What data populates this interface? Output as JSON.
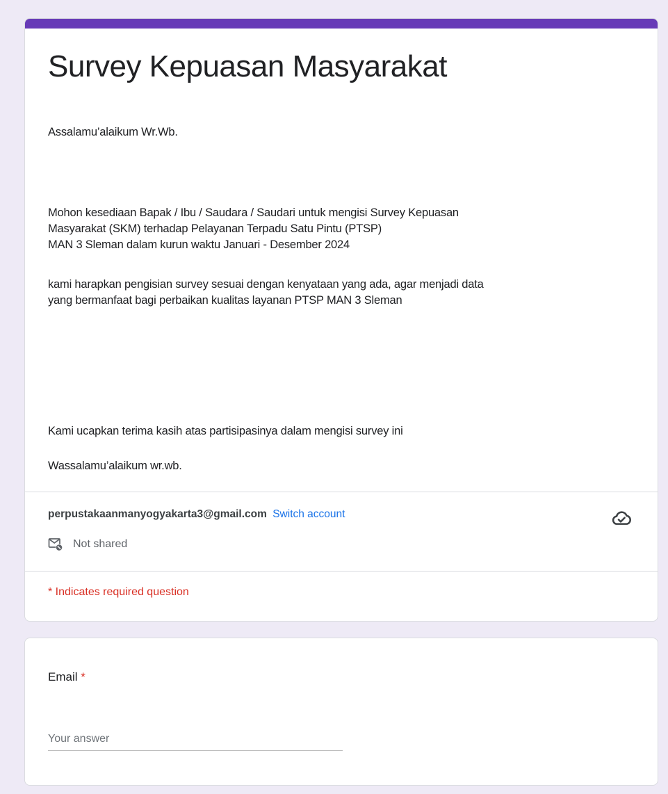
{
  "form": {
    "accent_color": "#673ab7",
    "title": "Survey Kepuasan Masyarakat",
    "description": {
      "greeting": "Assalamu’alaikum Wr.Wb.",
      "para1_line1": "Mohon kesediaan Bapak / Ibu / Saudara / Saudari untuk mengisi Survey Kepuasan",
      "para1_line2": "Masyarakat (SKM) terhadap Pelayanan Terpadu Satu Pintu (PTSP)",
      "para1_line3": "MAN 3 Sleman  dalam kurun waktu Januari - Desember 2024",
      "para2_line1": "kami harapkan pengisian survey sesuai dengan kenyataan yang ada, agar menjadi data",
      "para2_line2": "yang bermanfaat bagi perbaikan kualitas layanan PTSP MAN 3 Sleman",
      "thanks": "Kami ucapkan terima kasih atas partisipasinya dalam mengisi survey ini",
      "closing": "Wassalamu’alaikum wr.wb."
    }
  },
  "account": {
    "email": "perpustakaanmanyogyakarta3@gmail.com",
    "switch_label": "Switch account",
    "share_status": "Not shared",
    "save_icon": "cloud-check-icon",
    "share_icon": "mail-not-shared-icon"
  },
  "required_note": "* Indicates required question",
  "questions": [
    {
      "label": "Email",
      "required_marker": "*",
      "placeholder": "Your answer"
    }
  ]
}
